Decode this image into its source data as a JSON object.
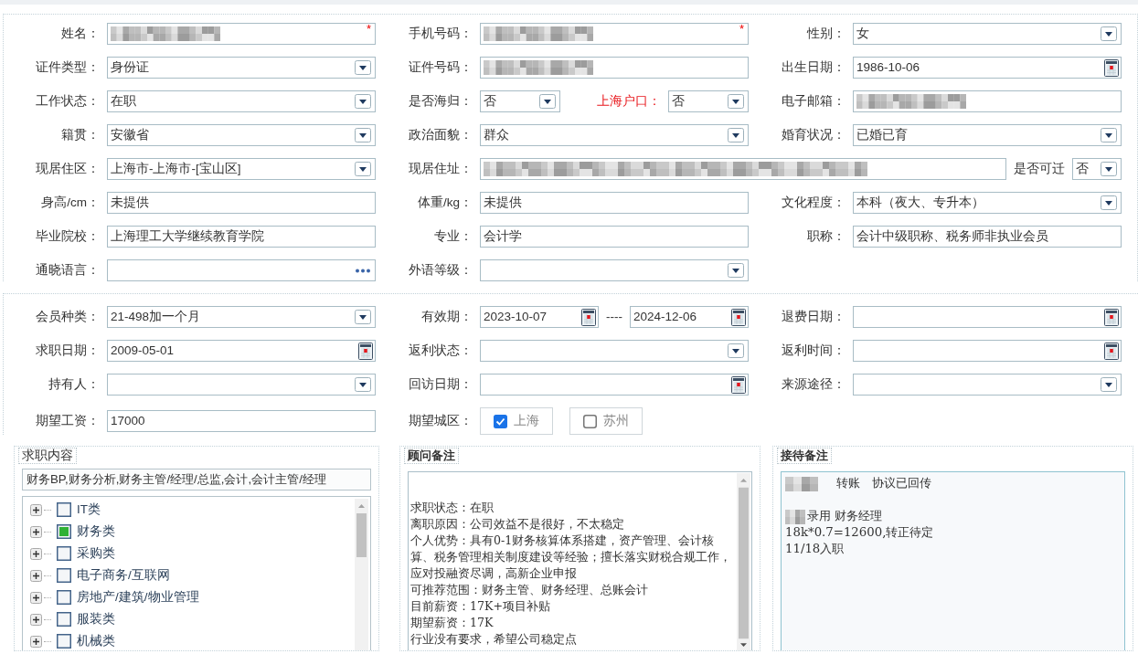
{
  "profile": {
    "rows": [
      [
        {
          "label": "姓名：",
          "controls": [
            {
              "kind": "text",
              "redacted": true,
              "required_mark": "*"
            }
          ]
        },
        {
          "label": "手机号码：",
          "controls": [
            {
              "kind": "text",
              "redacted": true,
              "required_mark": "*"
            }
          ]
        },
        {
          "label": "性别：",
          "controls": [
            {
              "kind": "select",
              "value": "女"
            }
          ]
        }
      ],
      [
        {
          "label": "证件类型：",
          "controls": [
            {
              "kind": "select",
              "value": "身份证"
            }
          ]
        },
        {
          "label": "证件号码：",
          "controls": [
            {
              "kind": "text",
              "redacted": true
            }
          ]
        },
        {
          "label": "出生日期：",
          "controls": [
            {
              "kind": "date",
              "value": "1986-10-06"
            }
          ]
        }
      ],
      [
        {
          "label": "工作状态：",
          "controls": [
            {
              "kind": "select",
              "value": "在职"
            }
          ]
        },
        {
          "label": "是否海归：",
          "controls": [
            {
              "kind": "select",
              "value": "否"
            },
            {
              "kind": "label",
              "text": "上海户口：",
              "highlight": true
            },
            {
              "kind": "select",
              "value": "否"
            }
          ]
        },
        {
          "label": "电子邮箱：",
          "controls": [
            {
              "kind": "text",
              "redacted": true
            }
          ]
        }
      ],
      [
        {
          "label": "籍贯：",
          "controls": [
            {
              "kind": "select",
              "value": "安徽省"
            }
          ]
        },
        {
          "label": "政治面貌：",
          "controls": [
            {
              "kind": "select",
              "value": "群众"
            }
          ]
        },
        {
          "label": "婚育状况：",
          "controls": [
            {
              "kind": "select",
              "value": "已婚已育"
            }
          ]
        }
      ],
      [
        {
          "label": "现居住区：",
          "controls": [
            {
              "kind": "select",
              "value": "上海市-上海市-[宝山区]"
            }
          ]
        },
        {
          "label": "现居住址：",
          "wide": true,
          "controls": [
            {
              "kind": "text",
              "redacted": true
            },
            {
              "kind": "label",
              "text": "是否可迁",
              "highlight": false
            },
            {
              "kind": "select",
              "value": "否"
            }
          ]
        }
      ],
      [
        {
          "label": "身高/cm：",
          "controls": [
            {
              "kind": "text",
              "value": "未提供"
            }
          ]
        },
        {
          "label": "体重/kg：",
          "controls": [
            {
              "kind": "text",
              "value": "未提供"
            }
          ]
        },
        {
          "label": "文化程度：",
          "controls": [
            {
              "kind": "select",
              "value": "本科（夜大、专升本）"
            }
          ]
        }
      ],
      [
        {
          "label": "毕业院校：",
          "controls": [
            {
              "kind": "text",
              "value": "上海理工大学继续教育学院"
            }
          ]
        },
        {
          "label": "专业：",
          "controls": [
            {
              "kind": "text",
              "value": "会计学"
            }
          ]
        },
        {
          "label": "职称：",
          "controls": [
            {
              "kind": "text",
              "value": "会计中级职称、税务师非执业会员"
            }
          ]
        }
      ],
      [
        {
          "label": "通晓语言：",
          "controls": [
            {
              "kind": "picker"
            }
          ]
        },
        {
          "label": "外语等级：",
          "controls": [
            {
              "kind": "select"
            }
          ]
        }
      ]
    ]
  },
  "membership": {
    "rows": [
      [
        {
          "label": "会员种类：",
          "controls": [
            {
              "kind": "select",
              "value": "21-498加一个月"
            }
          ]
        },
        {
          "label": "有效期：",
          "controls": [
            {
              "kind": "date",
              "value": "2023-10-07"
            },
            {
              "kind": "separator",
              "text": "----"
            },
            {
              "kind": "date",
              "value": "2024-12-06"
            }
          ]
        },
        {
          "label": "退费日期：",
          "controls": [
            {
              "kind": "date"
            }
          ]
        }
      ],
      [
        {
          "label": "求职日期：",
          "controls": [
            {
              "kind": "date",
              "value": "2009-05-01"
            }
          ]
        },
        {
          "label": "返利状态：",
          "controls": [
            {
              "kind": "select"
            }
          ]
        },
        {
          "label": "返利时间：",
          "controls": [
            {
              "kind": "date"
            }
          ]
        }
      ],
      [
        {
          "label": "持有人：",
          "controls": [
            {
              "kind": "select"
            }
          ]
        },
        {
          "label": "回访日期：",
          "controls": [
            {
              "kind": "date"
            }
          ]
        },
        {
          "label": "来源途径：",
          "controls": [
            {
              "kind": "select"
            }
          ]
        }
      ],
      [
        {
          "label": "期望工资：",
          "controls": [
            {
              "kind": "text",
              "value": "17000"
            }
          ]
        },
        {
          "label": "期望城区：",
          "controls": [
            {
              "kind": "checkbox",
              "label": "上海",
              "checked": true
            },
            {
              "kind": "checkbox",
              "label": "苏州",
              "checked": false
            }
          ]
        }
      ]
    ]
  },
  "job_panel": {
    "title": "求职内容",
    "summary": "财务BP,财务分析,财务主管/经理/总监,会计,会计主管/经理",
    "tree": [
      {
        "label": "IT类",
        "checked": false,
        "expanded": false
      },
      {
        "label": "财务类",
        "checked": true,
        "expanded": false
      },
      {
        "label": "采购类",
        "checked": false,
        "expanded": false
      },
      {
        "label": "电子商务/互联网",
        "checked": false,
        "expanded": false
      },
      {
        "label": "房地产/建筑/物业管理",
        "checked": false,
        "expanded": false
      },
      {
        "label": "服装类",
        "checked": false,
        "expanded": false
      },
      {
        "label": "机械类",
        "checked": false,
        "expanded": false
      }
    ]
  },
  "consultant_panel": {
    "title": "顾问备注",
    "paragraphs": [
      "求职状态：在职",
      "离职原因：公司效益不是很好，不太稳定",
      "个人优势：具有0-1财务核算体系搭建，资产管理、会计核算、税务管理相关制度建设等经验；擅长落实财税合规工作，应对投融资尽调，高新企业申报",
      "可推荐范围：财务主管、财务经理、总账会计",
      "目前薪资：17K+项目补贴",
      "期望薪资：17K",
      "行业没有要求，希望公司稳定点"
    ]
  },
  "reception_panel": {
    "title": "接待备注",
    "lines": [
      {
        "text": "转账   协议已回传",
        "redacted_prefix": true,
        "gap_before": false
      },
      {
        "text": "录用 财务经理",
        "redacted_prefix": true,
        "gap_before": true
      },
      {
        "text": "18k*0.7=12600,转正待定",
        "redacted_prefix": false,
        "gap_before": false
      },
      {
        "text": "11/18入职",
        "redacted_prefix": false,
        "gap_before": false
      }
    ]
  }
}
